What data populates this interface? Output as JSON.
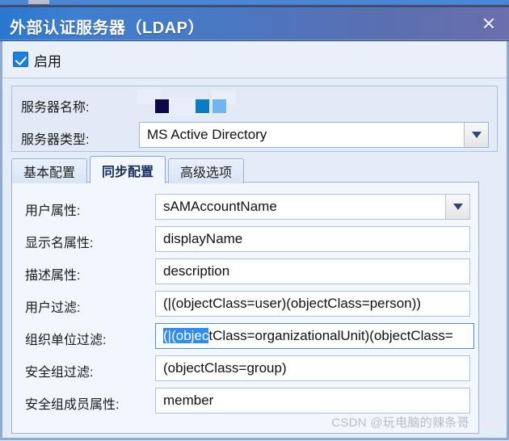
{
  "window": {
    "title": "外部认证服务器（LDAP）",
    "close_icon": "close-icon",
    "close_glyph": "✕"
  },
  "enable": {
    "label": "启用",
    "checked": true
  },
  "server": {
    "name_label": "服务器名称:",
    "name_value_redacted": true,
    "redaction_colors": [
      "#0a0a4a",
      "#0b7cc0",
      "#72b4f0"
    ],
    "type_label": "服务器类型:",
    "type_value": "MS Active Directory",
    "type_dropdown_icon": "chevron-down-icon"
  },
  "tabs": [
    {
      "label": "基本配置",
      "active": false
    },
    {
      "label": "同步配置",
      "active": true
    },
    {
      "label": "高级选项",
      "active": false
    }
  ],
  "sync_form": {
    "rows": [
      {
        "label": "用户属性:",
        "value": "sAMAccountName",
        "type": "combo",
        "icon": "chevron-down-icon",
        "focused": false
      },
      {
        "label": "显示名属性:",
        "value": "displayName",
        "type": "text",
        "focused": false
      },
      {
        "label": "描述属性:",
        "value": "description",
        "type": "text",
        "focused": false
      },
      {
        "label": "用户过滤:",
        "value": "(|(objectClass=user)(objectClass=person))",
        "type": "text",
        "focused": false
      },
      {
        "label": "组织单位过滤:",
        "value": "(|(objectClass=organizationalUnit)(objectClass=",
        "selected_text": "(|(objec",
        "rest_text": "tClass=organizationalUnit)(objectClass=",
        "type": "text",
        "focused": true
      },
      {
        "label": "安全组过滤:",
        "value": "(objectClass=group)",
        "type": "text",
        "focused": false
      },
      {
        "label": "安全组成员属性:",
        "value": "member",
        "type": "text",
        "focused": false
      }
    ]
  },
  "watermark": {
    "text": "CSDN @玩电脑的辣条哥"
  }
}
